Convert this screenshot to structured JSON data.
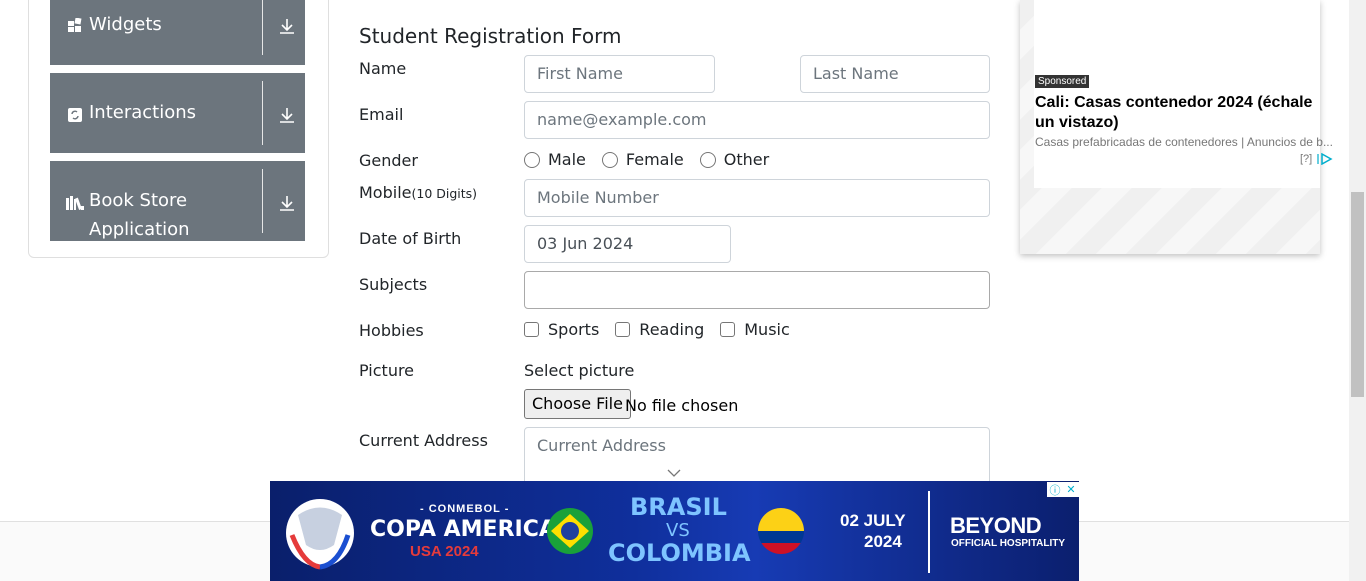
{
  "sidebar": {
    "groups": [
      {
        "label": "Widgets",
        "icon": "widgets-icon"
      },
      {
        "label": "Interactions",
        "icon": "interactions-icon"
      },
      {
        "label": "Book Store Application",
        "label_line1": "Book Store",
        "label_line2": "Application",
        "icon": "books-icon"
      }
    ]
  },
  "form": {
    "title": "Student Registration Form",
    "name_label": "Name",
    "first_name_placeholder": "First Name",
    "last_name_placeholder": "Last Name",
    "email_label": "Email",
    "email_placeholder": "name@example.com",
    "gender_label": "Gender",
    "gender_options": [
      "Male",
      "Female",
      "Other"
    ],
    "mobile_label": "Mobile",
    "mobile_hint": "(10 Digits)",
    "mobile_placeholder": "Mobile Number",
    "dob_label": "Date of Birth",
    "dob_value": "03 Jun 2024",
    "subjects_label": "Subjects",
    "hobbies_label": "Hobbies",
    "hobby_options": [
      "Sports",
      "Reading",
      "Music"
    ],
    "picture_label": "Picture",
    "select_picture": "Select picture",
    "choose_file": "Choose File",
    "no_file": "No file chosen",
    "address_label": "Current Address",
    "address_placeholder": "Current Address"
  },
  "ad_right": {
    "sponsored": "Sponsored",
    "headline": "Cali: Casas contenedor 2024 (échale un vistazo)",
    "subtext": "Casas prefabricadas de contenedores | Anuncios de b...",
    "help": "[?]"
  },
  "banner": {
    "conmebol": "- CONMEBOL -",
    "copa": "COPA AMERICA",
    "usa": "USA 2024",
    "team1": "BRASIL",
    "vs": "VS",
    "team2": "COLOMBIA",
    "date_line1": "02 JULY",
    "date_line2": "2024",
    "brand": "BEYOND",
    "brand_sub": "OFFICIAL HOSPITALITY",
    "info": "ⓘ",
    "close": "✕"
  },
  "colors": {
    "accordion": "#6c757d",
    "input_border": "#ced4da",
    "banner_blue": "#0f2f9c"
  }
}
